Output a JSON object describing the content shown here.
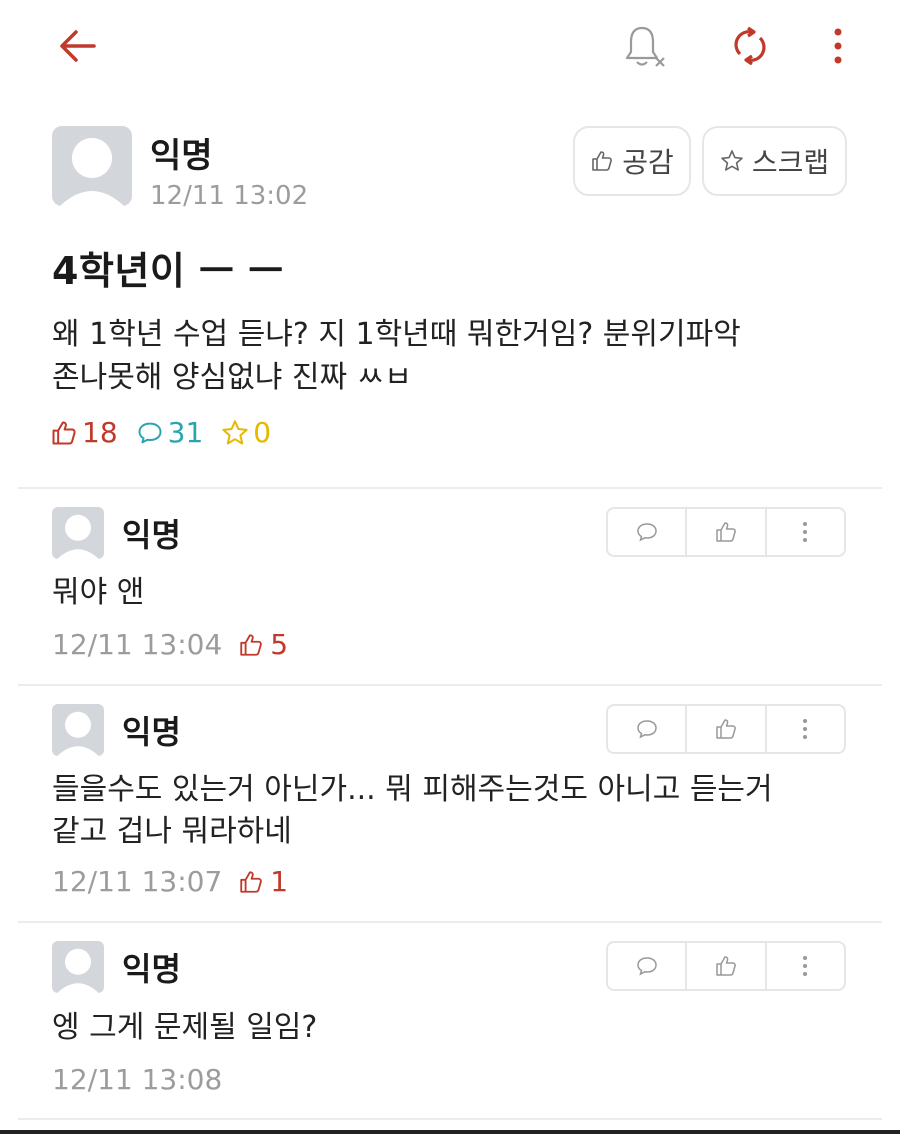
{
  "colors": {
    "accent": "#c0392b",
    "comment_teal": "#2aa5b0",
    "scrap_gold": "#e6b800",
    "muted": "#9c9c9c"
  },
  "topbar": {
    "icons": [
      "back-arrow-icon",
      "bell-off-icon",
      "refresh-icon",
      "more-vertical-icon"
    ]
  },
  "post": {
    "author": "익명",
    "time": "12/11 13:02",
    "like_button": "공감",
    "scrap_button": "스크랩",
    "title": "4학년이 ㅡ ㅡ",
    "body_line1": "왜 1학년 수업 듣냐? 지 1학년때 뭐한거임? 분위기파악",
    "body_line2": "존나못해 양심없냐 진짜 ㅆㅂ",
    "stats": {
      "likes": "18",
      "comments": "31",
      "scraps": "0"
    }
  },
  "comments": [
    {
      "author": "익명",
      "text_line1": "뭐야 앤",
      "text_line2": "",
      "time": "12/11 13:04",
      "likes": "5"
    },
    {
      "author": "익명",
      "text_line1": "들을수도 있는거 아닌가... 뭐 피해주는것도 아니고 듣는거",
      "text_line2": "같고 겁나 뭐라하네",
      "time": "12/11 13:07",
      "likes": "1"
    },
    {
      "author": "익명",
      "text_line1": "엥 그게 문제될 일임?",
      "text_line2": "",
      "time": "12/11 13:08",
      "likes": ""
    }
  ]
}
